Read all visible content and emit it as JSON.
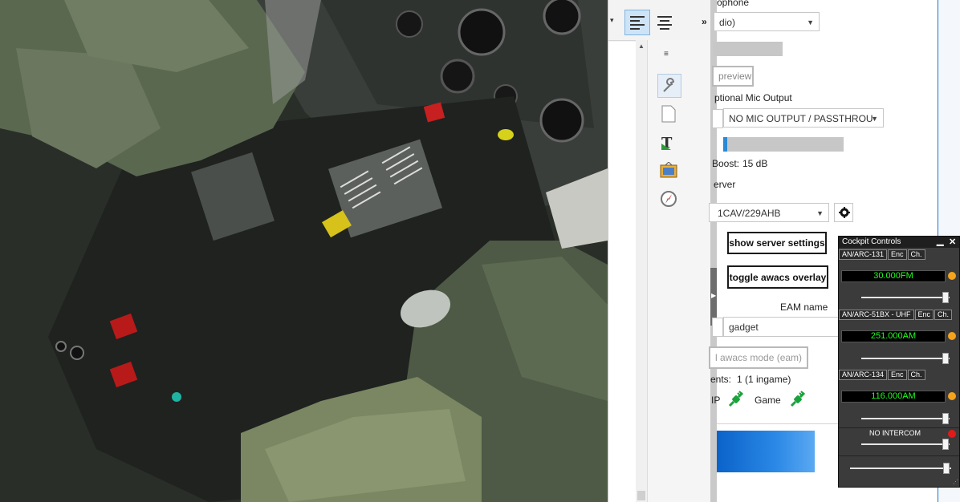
{
  "doc": {
    "align_left_icon": "align-left-icon",
    "align_center_icon": "align-center-icon",
    "more_label": "»",
    "tool_icons": [
      "wrench-icon",
      "page-icon",
      "text-tool-icon",
      "picture-frame-icon",
      "compass-icon"
    ]
  },
  "srs": {
    "mic_label": "ophone",
    "mic_device": "dio)",
    "preview_label": "preview",
    "optional_mic_label": "ptional Mic Output",
    "mic_output_value": "NO MIC OUTPUT / PASSTHROU",
    "boost_label": "Boost:",
    "boost_value": "15 dB",
    "server_label": "erver",
    "server_value": "1CAV/229AHB",
    "show_server_settings": "show server settings",
    "toggle_awacs_overlay": "toggle awacs overlay",
    "eam_name_label": "EAM name",
    "eam_name_value": "gadget",
    "awacs_mode_label": "l awacs mode (eam)",
    "clients_label": "ents:",
    "clients_value": "1 (1 ingame)",
    "voip_label": "IP",
    "game_label": "Game",
    "colors": {
      "connected": "#1aa33c"
    }
  },
  "cockpit_controls": {
    "title": "Cockpit Controls",
    "minimize": "▁",
    "close": "✕",
    "radios": [
      {
        "name": "AN/ARC-131",
        "enc": "Enc",
        "ch": "Ch.",
        "freq": "30.000FM",
        "led": "#f4a31c",
        "volume": 0.95
      },
      {
        "name": "AN/ARC-51BX - UHF",
        "enc": "Enc",
        "ch": "Ch.",
        "freq": "251.000AM",
        "led": "#f4a31c",
        "volume": 0.95
      },
      {
        "name": "AN/ARC-134",
        "enc": "Enc",
        "ch": "Ch.",
        "freq": "116.000AM",
        "led": "#f4a31c",
        "volume": 0.95
      }
    ],
    "intercom": {
      "label": "NO INTERCOM",
      "led": "#e01b1b",
      "volume": 0.95
    },
    "master_volume": 0.95
  }
}
